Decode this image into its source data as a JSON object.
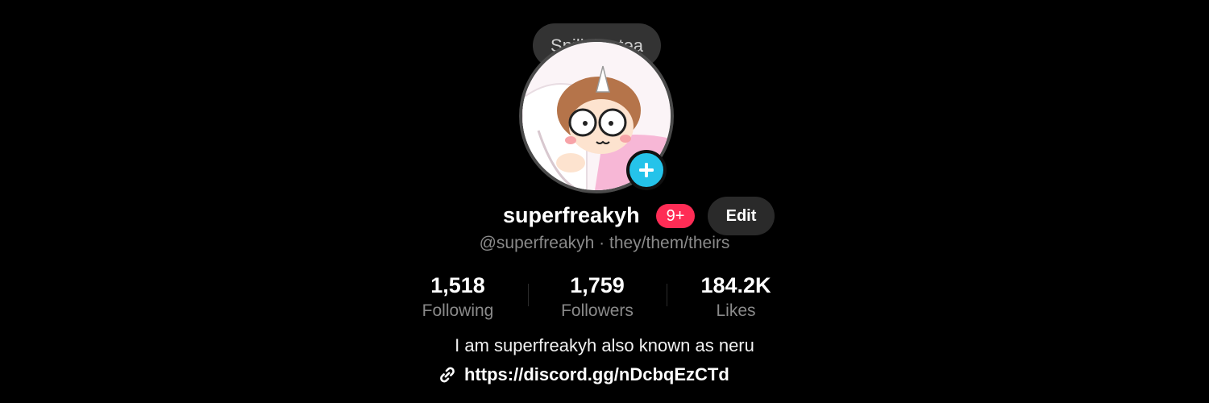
{
  "profile": {
    "avatar_alt": "cartoon avatar",
    "tooltip": "Spill the tea",
    "username": "superfreakyh",
    "notification_badge": "9+",
    "edit_label": "Edit",
    "handle_line": "@superfreakyh · they/them/theirs",
    "stats": [
      {
        "value": "1,518",
        "label": "Following"
      },
      {
        "value": "1,759",
        "label": "Followers"
      },
      {
        "value": "184.2K",
        "label": "Likes"
      }
    ],
    "bio": "I am superfreakyh also known as neru",
    "link": "https://discord.gg/nDcbqEzCTd"
  },
  "colors": {
    "background": "#000000",
    "badge_red": "#fe2c55",
    "add_blue": "#25c3ea"
  },
  "icons": [
    "plus-icon",
    "link-icon"
  ]
}
